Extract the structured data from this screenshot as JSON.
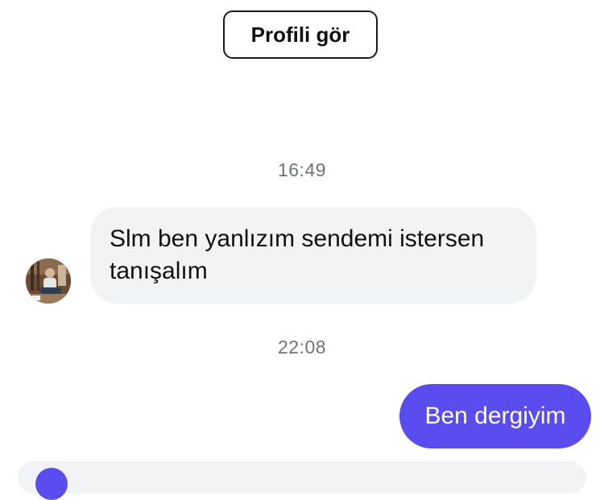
{
  "header": {
    "profile_button_label": "Profili gör"
  },
  "conversation": {
    "messages": [
      {
        "timestamp": "16:49",
        "direction": "incoming",
        "text": "Slm ben yanlızım sendemi istersen tanışalım"
      },
      {
        "timestamp": "22:08",
        "direction": "outgoing",
        "text": "Ben dergiyim"
      }
    ]
  },
  "colors": {
    "outgoing_bubble": "#5a4df0",
    "incoming_bubble": "#f1f3f5",
    "timestamp_text": "#6f7378"
  },
  "icons": {
    "sender_avatar": "avatar"
  }
}
